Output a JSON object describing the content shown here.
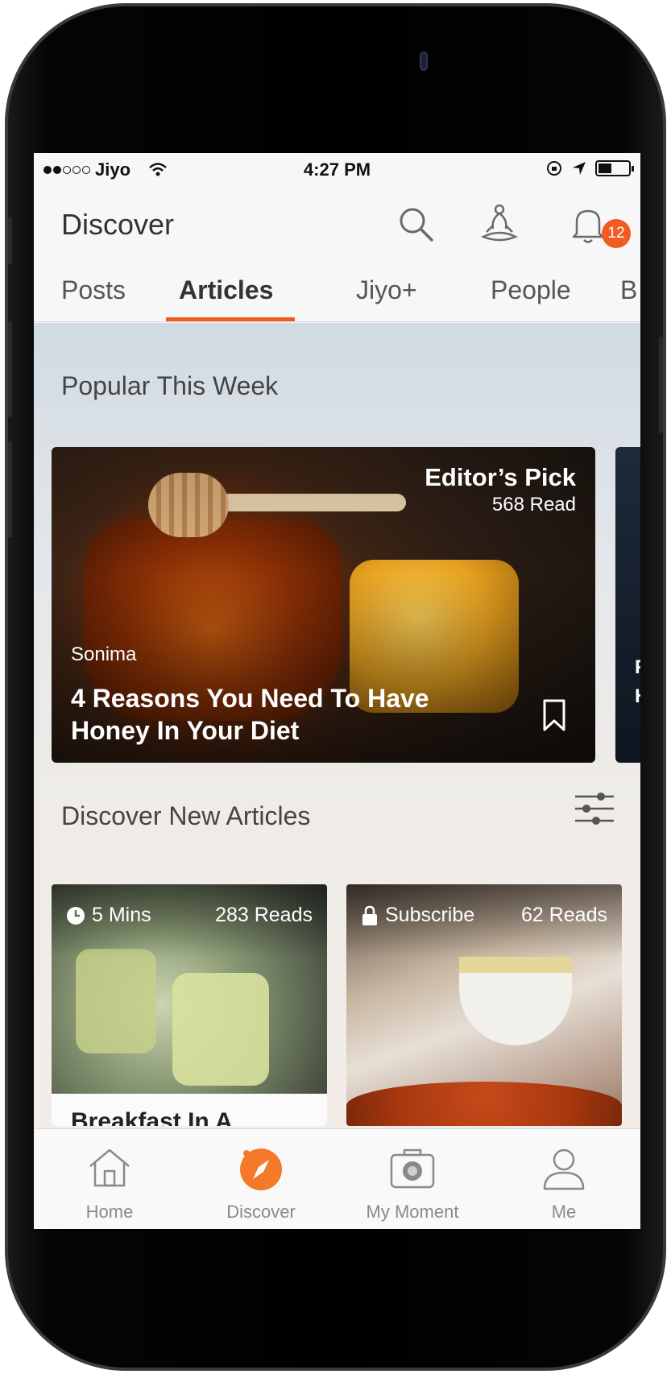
{
  "status_bar": {
    "carrier": "Jiyo",
    "time": "4:27 PM",
    "signal_bars_filled": 2,
    "signal_bars_total": 5,
    "battery_level": 0.45
  },
  "header": {
    "title": "Discover",
    "notification_count": "12",
    "accent_color": "#f25b23"
  },
  "tabs": [
    {
      "label": "Posts"
    },
    {
      "label": "Articles"
    },
    {
      "label": "Jiyo+"
    },
    {
      "label": "People"
    },
    {
      "label": "B"
    }
  ],
  "active_tab": "Articles",
  "popular": {
    "title": "Popular This Week",
    "featured": {
      "badge": "Editor’s Pick",
      "reads": "568 Read",
      "author": "Sonima",
      "headline": "4 Reasons You Need To Have Honey In Your Diet"
    },
    "next_peek": {
      "author_initial": "F",
      "headline_initial": "H"
    }
  },
  "discover": {
    "title": "Discover New Articles",
    "cards": [
      {
        "left_meta": "5 Mins",
        "left_icon": "clock-icon",
        "reads": "283 Reads",
        "caption": "Breakfast In A"
      },
      {
        "left_meta": "Subscribe",
        "left_icon": "lock-icon",
        "reads": "62 Reads",
        "caption": ""
      }
    ]
  },
  "bottom_nav": [
    {
      "label": "Home",
      "icon": "home-icon"
    },
    {
      "label": "Discover",
      "icon": "compass-icon"
    },
    {
      "label": "My Moment",
      "icon": "camera-icon"
    },
    {
      "label": "Me",
      "icon": "person-icon"
    }
  ]
}
